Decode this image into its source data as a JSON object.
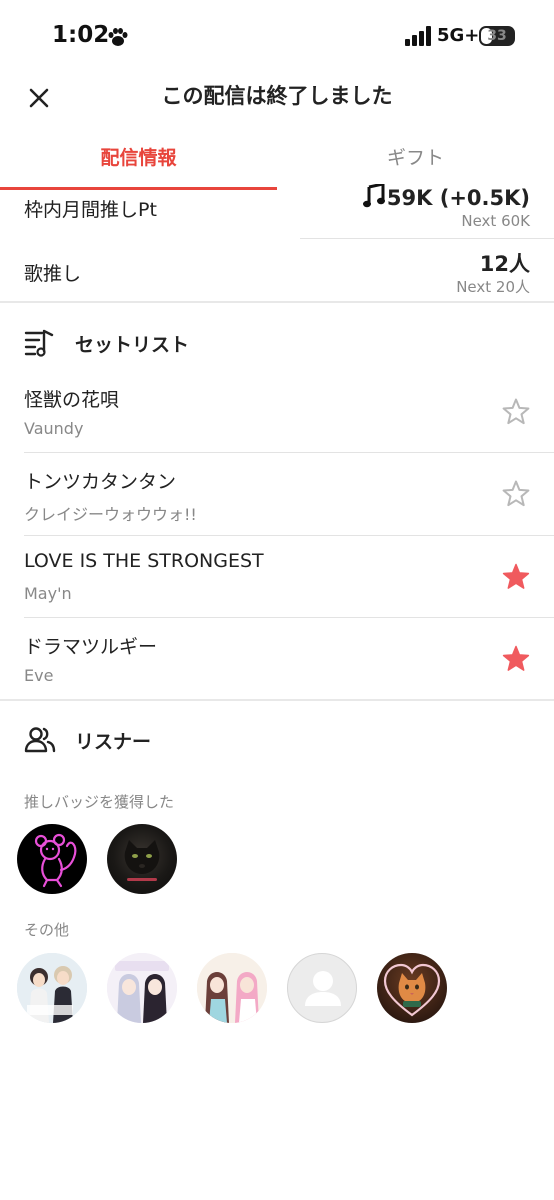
{
  "status_bar": {
    "time": "1:02",
    "network": "5G+",
    "battery": "33",
    "battery_level": 0.33,
    "icons": [
      "paw-icon",
      "signal-icon",
      "battery-icon"
    ]
  },
  "header": {
    "title": "この配信は終了しました",
    "close_icon": "close-icon"
  },
  "tabs": [
    {
      "label": "配信情報",
      "active": true
    },
    {
      "label": "ギフト",
      "active": false
    }
  ],
  "colors": {
    "accent": "#e8453c",
    "star_filled": "#f05a5e",
    "star_outline": "#b8b8b8",
    "secondary_text": "#888888"
  },
  "stats": [
    {
      "label": "枠内月間推しPt",
      "value": "59K (+0.5K)",
      "sub": "Next 60K",
      "icon": "music-note-icon"
    },
    {
      "label": "歌推し",
      "value": "12人",
      "sub": "Next 20人"
    }
  ],
  "setlist": {
    "title": "セットリスト",
    "icon": "setlist-icon",
    "items": [
      {
        "title": "怪獣の花唄",
        "artist": "Vaundy",
        "starred": false
      },
      {
        "title": "トンツカタンタン",
        "artist": "クレイジーウォウウォ!!",
        "starred": false
      },
      {
        "title": "LOVE IS THE STRONGEST",
        "artist": "May'n",
        "starred": true
      },
      {
        "title": "ドラマツルギー",
        "artist": "Eve",
        "starred": true
      }
    ]
  },
  "listeners": {
    "title": "リスナー",
    "icon": "users-icon",
    "badge_label": "推しバッジを獲得した",
    "other_label": "その他",
    "badge_avatars": [
      "avatar-neon-mouse",
      "avatar-black-panther"
    ],
    "other_avatars": [
      "avatar-anime-1",
      "avatar-anime-2",
      "avatar-anime-3",
      "avatar-default",
      "avatar-cat-heart"
    ]
  }
}
